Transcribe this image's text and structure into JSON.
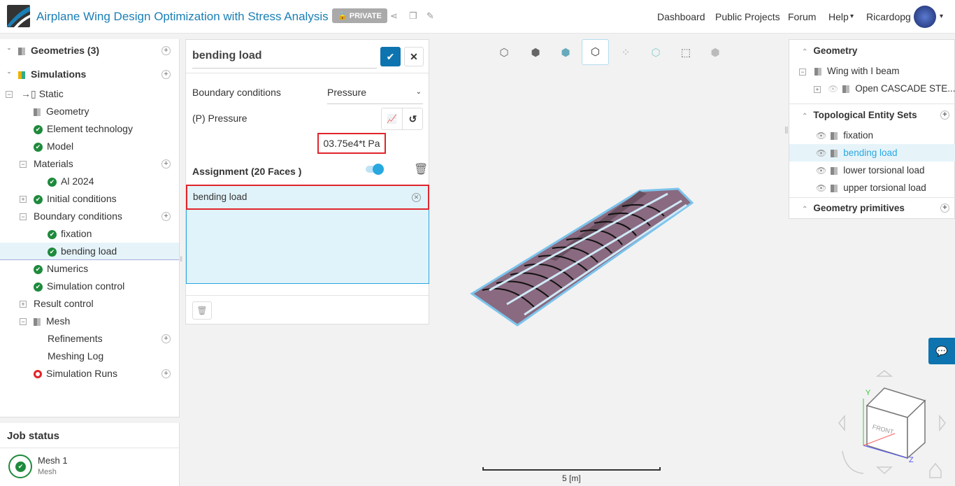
{
  "header": {
    "title": "Airplane Wing Design Optimization with Stress Analysis",
    "privacy_badge": "PRIVATE",
    "nav": [
      "Dashboard",
      "Public Projects",
      "Forum",
      "Help",
      "Ricardopg"
    ]
  },
  "tree": [
    {
      "label": "Geometries (3)",
      "level": 0,
      "bold": true,
      "icon": "geometry-icon",
      "plus": true,
      "exp": "chevron"
    },
    {
      "label": "Simulations",
      "level": 0,
      "bold": true,
      "icon": "simulation-icon",
      "plus": true,
      "exp": "chevron"
    },
    {
      "label": "Static",
      "level": 0,
      "icon": "static-icon",
      "exp": "-"
    },
    {
      "label": "Geometry",
      "level": 1,
      "icon": "geometry-check-icon"
    },
    {
      "label": "Element technology",
      "level": 1,
      "icon": "check-icon"
    },
    {
      "label": "Model",
      "level": 1,
      "icon": "check-icon"
    },
    {
      "label": "Materials",
      "level": 1,
      "plus": true,
      "exp": "-"
    },
    {
      "label": "Al 2024",
      "level": 2,
      "icon": "check-icon"
    },
    {
      "label": "Initial conditions",
      "level": 1,
      "icon": "check-icon",
      "exp": "+"
    },
    {
      "label": "Boundary conditions",
      "level": 1,
      "plus": true,
      "exp": "-"
    },
    {
      "label": "fixation",
      "level": 2,
      "icon": "check-icon"
    },
    {
      "label": "bending load",
      "level": 2,
      "icon": "check-icon",
      "selected": true
    },
    {
      "label": "Numerics",
      "level": 1,
      "icon": "check-icon"
    },
    {
      "label": "Simulation control",
      "level": 1,
      "icon": "check-icon"
    },
    {
      "label": "Result control",
      "level": 1,
      "exp": "+"
    },
    {
      "label": "Mesh",
      "level": 1,
      "icon": "mesh-icon",
      "exp": "-"
    },
    {
      "label": "Refinements",
      "level": 2,
      "plus": true
    },
    {
      "label": "Meshing Log",
      "level": 2
    },
    {
      "label": "Simulation Runs",
      "level": 1,
      "icon": "error-icon",
      "plus": true
    }
  ],
  "job_status": {
    "title": "Job status",
    "item_name": "Mesh 1",
    "item_type": "Mesh"
  },
  "panel": {
    "name": "bending load",
    "bc_label": "Boundary conditions",
    "bc_type": "Pressure",
    "pressure_label": "(P) Pressure",
    "pressure_value": "03.75e4*t Pa",
    "assignment_label": "Assignment (20 Faces )",
    "assigned_item": "bending load",
    "toggle_on": true
  },
  "right": {
    "geometry_title": "Geometry",
    "geometry_root": "Wing with I beam",
    "geometry_child": "Open CASCADE STE...",
    "tes_title": "Topological Entity Sets",
    "tes_items": [
      "fixation",
      "bending load",
      "lower torsional load",
      "upper torsional load"
    ],
    "tes_selected": "bending load",
    "primitives_title": "Geometry primitives"
  },
  "viewport": {
    "scale_label": "5 [m]",
    "cube_front": "FRONT",
    "axis_y": "Y",
    "axis_z": "Z"
  },
  "colors": {
    "accent": "#0e74b0",
    "selected_text": "#29a8e0",
    "highlight": "#e0252b",
    "check": "#1e8a3c"
  }
}
